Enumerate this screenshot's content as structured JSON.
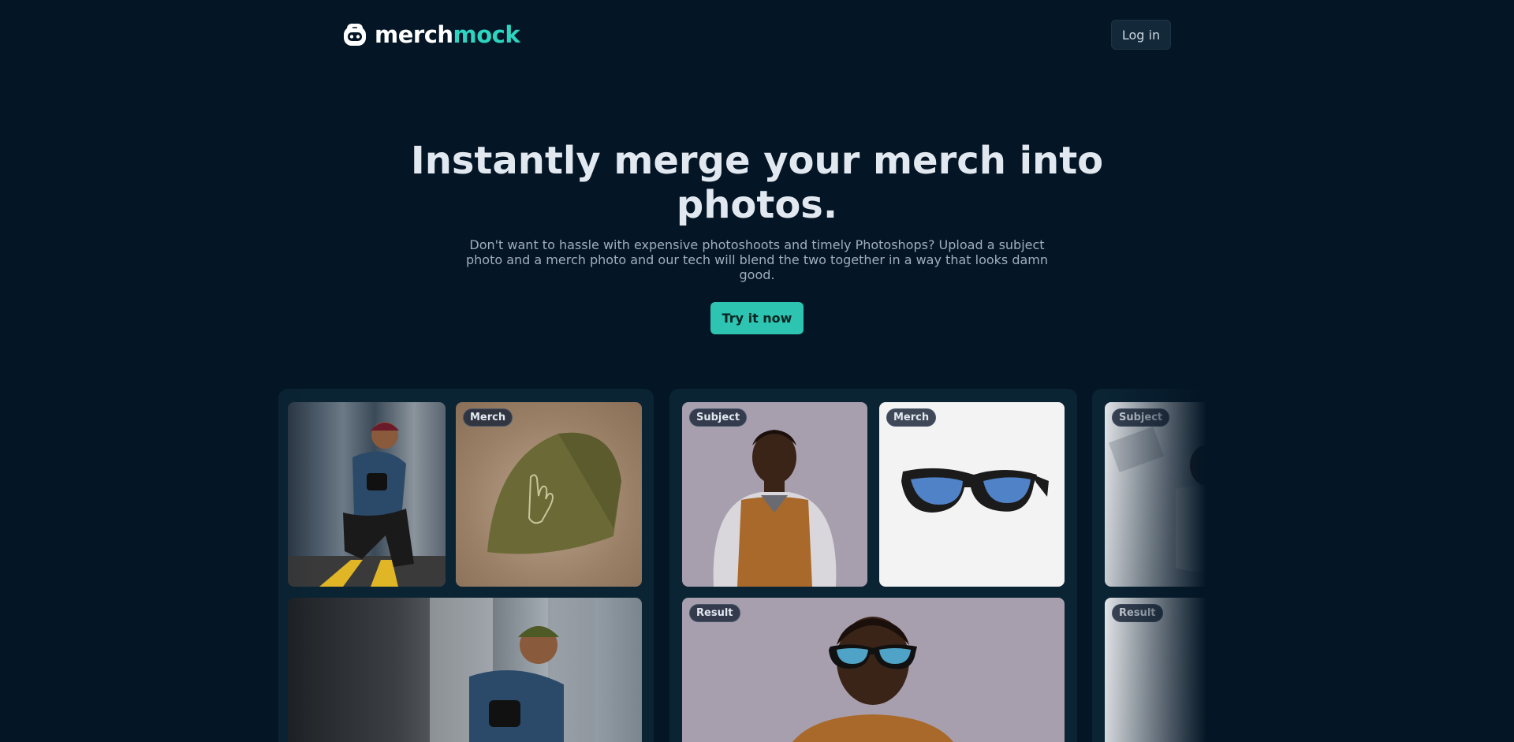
{
  "header": {
    "logo_word1": "merch",
    "logo_word2": "mock",
    "login_label": "Log in"
  },
  "hero": {
    "title": "Instantly merge your merch into photos.",
    "subtitle": "Don't want to hassle with expensive photoshoots and timely Photoshops? Upload a subject photo and a merch photo and our tech will blend the two together in a way that looks damn good.",
    "cta_label": "Try it now"
  },
  "gallery": {
    "cards": [
      {
        "subject_label": "",
        "merch_label": "Merch",
        "result_label": ""
      },
      {
        "subject_label": "Subject",
        "merch_label": "Merch",
        "result_label": "Result"
      },
      {
        "subject_label": "Subject",
        "result_label": "Result"
      }
    ]
  },
  "colors": {
    "background": "#041525",
    "accent": "#2dd4bf",
    "card": "#0b2434"
  },
  "icons": [
    "merchmock-logo-icon"
  ]
}
